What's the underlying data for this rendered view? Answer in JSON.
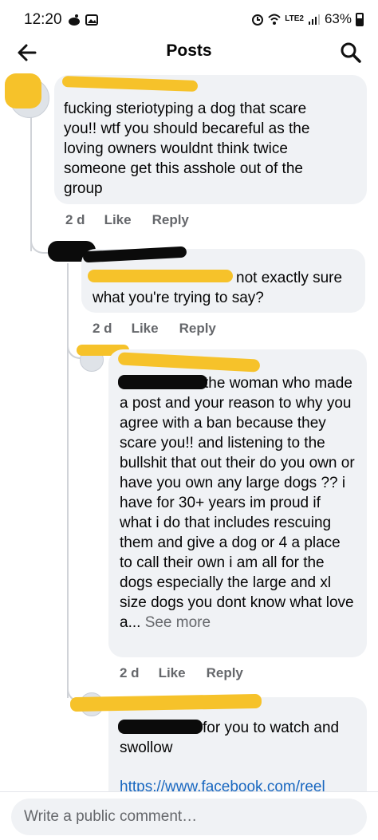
{
  "status_bar": {
    "time": "12:20",
    "battery": "63%",
    "network": "LTE2"
  },
  "header": {
    "title": "Posts"
  },
  "comments": [
    {
      "text": "fucking steriotyping a dog that scare you!! wtf you should becareful as the loving owners wouldnt think twice someone get this asshole out of the group",
      "time": "2 d",
      "like": "Like",
      "reply": "Reply"
    },
    {
      "text": "not exactly sure what you're trying to say?",
      "time": "2 d",
      "like": "Like",
      "reply": "Reply"
    },
    {
      "text": "the woman who made a post and your reason to why you agree with a ban because they scare you!! and listening to the bullshit that out their do you own or have you own any large dogs ?? i have for 30+ years im proud if what i do that includes rescuing them and give a dog or 4 a place to call their own i am all for the dogs especially the large and xl size dogs you dont know what love a...",
      "see_more": "See more",
      "time": "2 d",
      "like": "Like",
      "reply": "Reply"
    },
    {
      "text": "for you to watch and swollow",
      "link": "https://www.facebook.com/reel"
    }
  ],
  "composer": {
    "placeholder": "Write a public comment…"
  }
}
